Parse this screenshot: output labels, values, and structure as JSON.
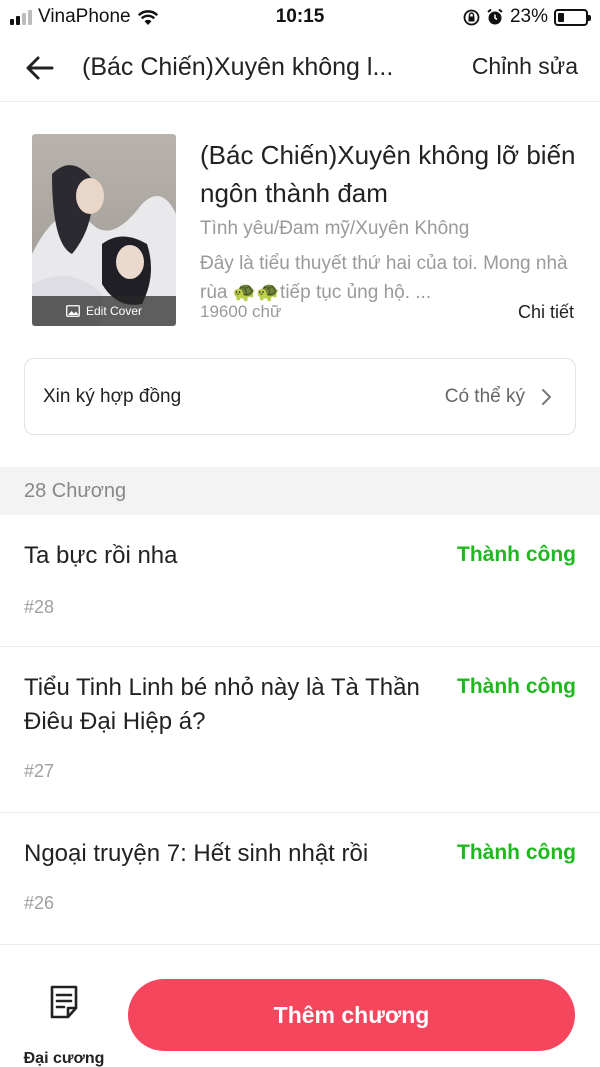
{
  "status_bar": {
    "carrier": "VinaPhone",
    "time": "10:15",
    "battery": "23%",
    "battery_level": 0.23,
    "icons": [
      "signal-icon",
      "wifi-icon",
      "rotation-lock-icon",
      "alarm-icon",
      "battery-icon"
    ]
  },
  "nav": {
    "back_icon": "back-arrow-icon",
    "title": "(Bác Chiến)Xuyên không l...",
    "edit_label": "Chỉnh sửa"
  },
  "book": {
    "cover_edit_label": "Edit Cover",
    "title": "(Bác Chiến)Xuyên không lỡ biến ngôn thành đam",
    "genre": "Tình yêu/Đam mỹ/Xuyên Không",
    "description": "Đây là tiểu thuyết thứ hai của toi. Mong nhà rùa 🐢🐢tiếp tục ủng hộ. ...",
    "word_count": "19600 chữ",
    "detail_label": "Chi tiết"
  },
  "contract": {
    "label": "Xin ký hợp đồng",
    "status": "Có thể ký"
  },
  "chapters": {
    "count_label": "28 Chương",
    "items": [
      {
        "title": "Ta bực rồi nha",
        "status": "Thành công",
        "number": "#28"
      },
      {
        "title": "Tiểu Tinh Linh bé nhỏ này là Tà Thần Điêu Đại Hiệp á?",
        "status": "Thành công",
        "number": "#27"
      },
      {
        "title": "Ngoại truyện 7: Hết sinh nhật rồi",
        "status": "Thành công",
        "number": "#26"
      }
    ]
  },
  "bottom": {
    "outline_label": "Đại cương",
    "add_chapter_label": "Thêm chương"
  },
  "colors": {
    "accent": "#f6465e",
    "success": "#1fb81f",
    "muted": "#9a9a9a"
  }
}
